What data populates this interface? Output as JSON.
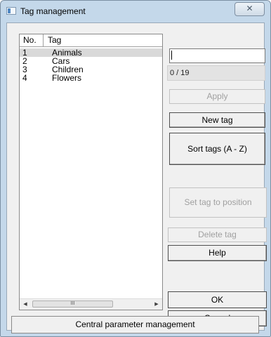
{
  "window": {
    "title": "Tag management",
    "close_symbol": "✕"
  },
  "table": {
    "columns": [
      "No.",
      "Tag"
    ],
    "rows": [
      {
        "no": "1",
        "tag": "Animals",
        "selected": true
      },
      {
        "no": "2",
        "tag": "Cars",
        "selected": false
      },
      {
        "no": "3",
        "tag": "Children",
        "selected": false
      },
      {
        "no": "4",
        "tag": "Flowers",
        "selected": false
      }
    ],
    "scrollbar": {
      "left_arrow": "◀",
      "right_arrow": "▶",
      "thumb_grip": "III"
    }
  },
  "editor": {
    "input_value": "",
    "counter": "0 / 19"
  },
  "buttons": {
    "apply": "Apply",
    "new_tag": "New tag",
    "sort_tags": "Sort tags (A - Z)",
    "set_tag_to_position": "Set tag to position",
    "delete_tag": "Delete tag",
    "help": "Help",
    "ok": "OK",
    "cancel": "Cancel",
    "central": "Central parameter management"
  },
  "icons": {
    "window": "app-window-icon",
    "close": "close-icon"
  }
}
